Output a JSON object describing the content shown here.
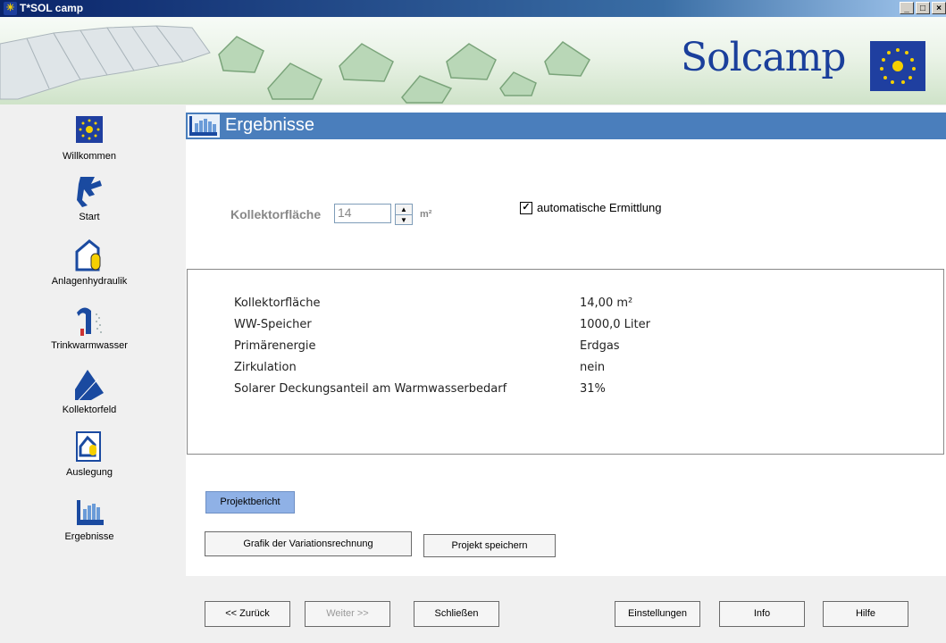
{
  "window": {
    "title": "T*SOL camp",
    "minimize": "_",
    "maximize": "□",
    "close": "×"
  },
  "banner": {
    "logo": "Solcamp"
  },
  "sidebar": {
    "items": [
      {
        "label": "Willkommen"
      },
      {
        "label": "Start"
      },
      {
        "label": "Anlagenhydraulik"
      },
      {
        "label": "Trinkwarmwasser"
      },
      {
        "label": "Kollektorfeld"
      },
      {
        "label": "Auslegung"
      },
      {
        "label": "Ergebnisse"
      }
    ]
  },
  "header": {
    "title": "Ergebnisse"
  },
  "collector": {
    "label": "Kollektorfläche",
    "value": "14",
    "unit": "m²",
    "auto_label": "automatische Ermittlung",
    "auto_checked": true
  },
  "results": {
    "rows": [
      {
        "label": "Kollektorfläche",
        "value": "14,00 m²"
      },
      {
        "label": "WW-Speicher",
        "value": "1000,0 Liter"
      },
      {
        "label": "Primärenergie",
        "value": "Erdgas"
      },
      {
        "label": "Zirkulation",
        "value": "nein"
      },
      {
        "label": "Solarer Deckungsanteil am Warmwasserbedarf",
        "value": "31%"
      }
    ]
  },
  "buttons": {
    "report": "Projektbericht",
    "chart": "Grafik der Variationsrechnung",
    "save": "Projekt speichern",
    "back": "<< Zurück",
    "next": "Weiter >>",
    "close": "Schließen",
    "settings": "Einstellungen",
    "info": "Info",
    "help": "Hilfe"
  },
  "colors": {
    "header_bg": "#4a7ebc",
    "report_button": "#8fb1e6",
    "logo": "#1a3f9b"
  }
}
